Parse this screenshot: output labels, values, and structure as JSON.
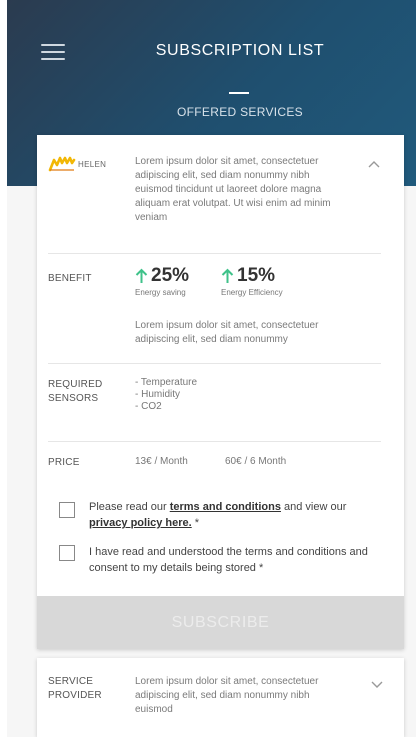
{
  "header": {
    "title": "SUBSCRIPTION LIST",
    "section": "OFFERED SERVICES",
    "menu_icon": "menu-icon"
  },
  "service": {
    "logo_text": "HELEN",
    "description": "Lorem ipsum dolor sit amet, consectetuer adipiscing elit, sed diam nonummy nibh euismod tincidunt ut laoreet dolore magna aliquam erat volutpat. Ut wisi enim ad minim veniam",
    "collapse_icon": "chevron-up-icon",
    "benefit": {
      "label": "BENEFIT",
      "stats": [
        {
          "value": "25%",
          "label": "Energy saving"
        },
        {
          "value": "15%",
          "label": "Energy Efficiency"
        }
      ],
      "description": "Lorem ipsum dolor sit amet, consectetuer adipiscing elit, sed diam nonummy"
    },
    "sensors": {
      "label_line1": "REQUIRED",
      "label_line2": "SENSORS",
      "items": [
        "- Temperature",
        "- Humidity",
        "- CO2"
      ]
    },
    "price": {
      "label": "PRICE",
      "monthly": "13€ / Month",
      "half_year": "60€ / 6 Month"
    },
    "consent1": {
      "prefix": "Please read our ",
      "terms_link": "terms and conditions",
      "middle": " and view our ",
      "privacy_link": "privacy policy here.",
      "suffix": " *"
    },
    "consent2": "I have read and understood the terms and conditions and consent to my details being stored *",
    "subscribe_label": "SUBSCRIBE"
  },
  "provider": {
    "label_line1": "SERVICE",
    "label_line2": "PROVIDER",
    "description": "Lorem ipsum dolor sit amet, consectetuer adipiscing elit, sed diam nonummy nibh euismod",
    "expand_icon": "chevron-down-icon"
  },
  "colors": {
    "header_bg": "#1f4f6f",
    "accent_green": "#3fc28a",
    "logo_yellow": "#f2b705",
    "button_disabled": "#d8d8d8"
  }
}
